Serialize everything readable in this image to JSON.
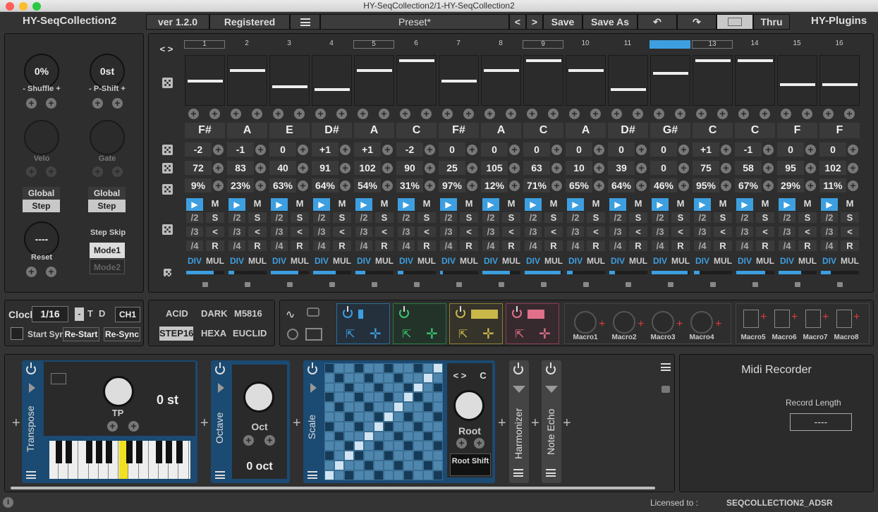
{
  "window": {
    "title": "HY-SeqCollection2/1-HY-SeqCollection2"
  },
  "header": {
    "app_name": "HY-SeqCollection2",
    "version": "ver 1.2.0",
    "registered": "Registered",
    "preset": "Preset*",
    "prev": "<",
    "next": ">",
    "save": "Save",
    "save_as": "Save As",
    "thru": "Thru",
    "brand": "HY-Plugins"
  },
  "left_panel": {
    "shuffle_value": "0%",
    "shuffle_label": "Shuffle",
    "pshift_value": "0st",
    "pshift_label": "P-Shift",
    "velo_label": "Velo",
    "gate_label": "Gate",
    "global1": "Global",
    "step1": "Step",
    "global2": "Global",
    "step2": "Step",
    "reset_value": "----",
    "reset_label": "Reset",
    "step_skip": "Step Skip",
    "mode1": "Mode1",
    "mode2": "Mode2"
  },
  "seq": {
    "nav": "< >",
    "step_numbers": [
      "1",
      "2",
      "3",
      "4",
      "5",
      "6",
      "7",
      "8",
      "9",
      "10",
      "11",
      "12",
      "13",
      "14",
      "15",
      "16"
    ],
    "bar_levels": [
      0.52,
      0.27,
      0.64,
      0.71,
      0.27,
      0.05,
      0.52,
      0.27,
      0.05,
      0.27,
      0.71,
      0.34,
      0.05,
      0.05,
      0.59,
      0.59
    ],
    "notes": [
      "F#",
      "A",
      "E",
      "D#",
      "A",
      "C",
      "F#",
      "A",
      "C",
      "A",
      "D#",
      "G#",
      "C",
      "C",
      "F",
      "F"
    ],
    "octaves": [
      "-2",
      "-1",
      "0",
      "+1",
      "+1",
      "-2",
      "0",
      "0",
      "0",
      "0",
      "0",
      "0",
      "+1",
      "-1",
      "0",
      "0"
    ],
    "velocities": [
      "72",
      "83",
      "40",
      "91",
      "102",
      "90",
      "25",
      "105",
      "63",
      "10",
      "39",
      "0",
      "75",
      "58",
      "95",
      "102"
    ],
    "probabilities": [
      "9%",
      "23%",
      "63%",
      "64%",
      "54%",
      "31%",
      "97%",
      "12%",
      "71%",
      "65%",
      "64%",
      "46%",
      "95%",
      "67%",
      "29%",
      "11%"
    ],
    "m": "M",
    "s": "S",
    "r": "R",
    "lt": "<",
    "d2": "/2",
    "d3": "/3",
    "d4": "/4",
    "div": "DIV",
    "mul": "MUL",
    "play": "▶",
    "length_levels": [
      0.72,
      0.15,
      0.72,
      0.6,
      0.25,
      0.15,
      0.08,
      0.72,
      0.95,
      0.15,
      0.15,
      0.95,
      0.15,
      0.75,
      0.6,
      0.25
    ],
    "highlight_step": 12
  },
  "clock": {
    "label": "Clock",
    "value": "1/16",
    "minus": "-",
    "t": "T",
    "d": "D",
    "channel": "CH1",
    "start_sync": "Start Sync",
    "restart": "Re-Start",
    "resync": "Re-Sync"
  },
  "modes": {
    "acid": "ACID",
    "dark": "DARK",
    "m5816": "M5816",
    "step16": "STEP16",
    "hexa": "HEXA",
    "euclid": "EUCLID"
  },
  "colors": {
    "accent": "#3d9fe0",
    "green": "#39c46a",
    "yellow": "#c8b84a",
    "pink": "#e0708a",
    "panel": "#2e2e2e",
    "blue_dark": "#1b4a72"
  },
  "macros": {
    "m1": "Macro1",
    "m2": "Macro2",
    "m3": "Macro3",
    "m4": "Macro4",
    "m5": "Macro5",
    "m6": "Macro6",
    "m7": "Macro7",
    "m8": "Macro8"
  },
  "modules": {
    "transpose": {
      "name": "Transpose",
      "knob_label": "TP",
      "value": "0 st"
    },
    "octave": {
      "name": "Octave",
      "knob_label": "Oct",
      "value": "0 oct"
    },
    "scale": {
      "name": "Scale",
      "nav": "< >",
      "key": "C",
      "root": "Root",
      "root_shift": "Root Shift"
    },
    "harmonizer": {
      "name": "Harmonizer"
    },
    "note_echo": {
      "name": "Note Echo"
    }
  },
  "recorder": {
    "title": "Midi Recorder",
    "record_length_label": "Record Length",
    "record_length_value": "----"
  },
  "footer": {
    "licensed_label": "Licensed to :",
    "licensed_value": "SEQCOLLECTION2_ADSR",
    "info": "i"
  }
}
